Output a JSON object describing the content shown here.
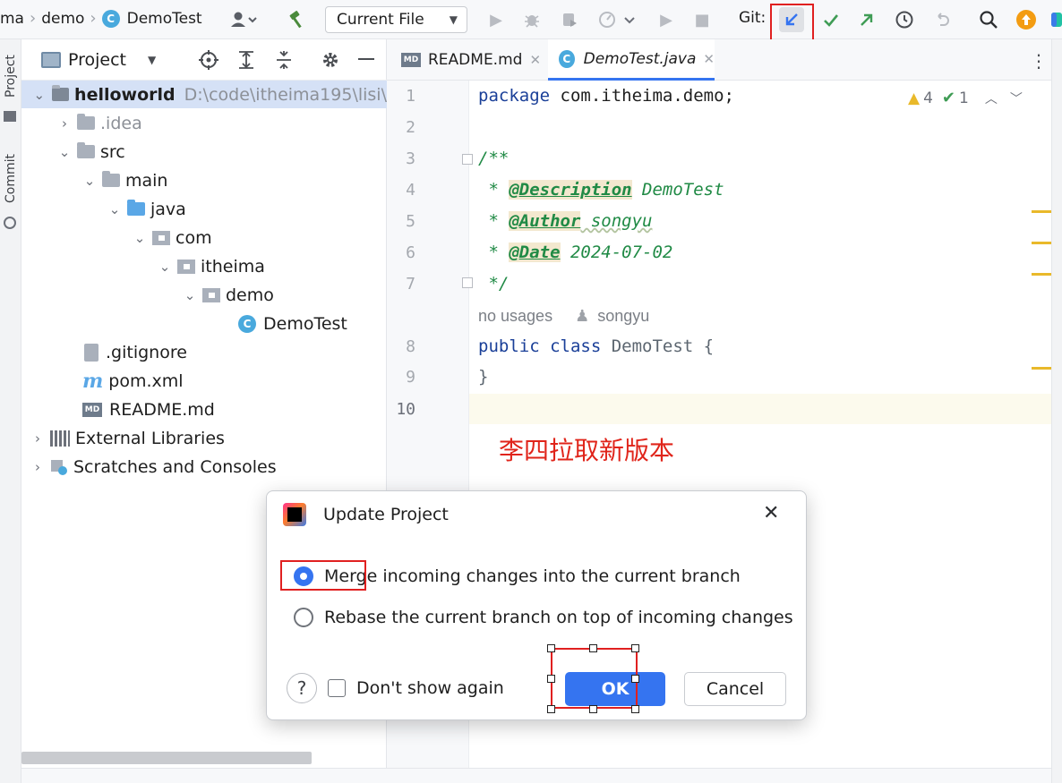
{
  "toolbar": {
    "breadcrumb_root": "ma",
    "breadcrumb_module": "demo",
    "breadcrumb_file": "DemoTest",
    "run_config": "Current File",
    "git_label": "Git:"
  },
  "left_strip": {
    "project_label": "Project",
    "commit_label": "Commit"
  },
  "project_panel": {
    "title": "Project",
    "tree": [
      {
        "label": "helloworld",
        "extra": "D:\\code\\itheima195\\lisi\\",
        "kind": "module"
      },
      {
        "label": ".idea",
        "kind": "folder"
      },
      {
        "label": "src",
        "kind": "folder"
      },
      {
        "label": "main",
        "kind": "folder"
      },
      {
        "label": "java",
        "kind": "folder-blue"
      },
      {
        "label": "com",
        "kind": "package"
      },
      {
        "label": "itheima",
        "kind": "package"
      },
      {
        "label": "demo",
        "kind": "package"
      },
      {
        "label": "DemoTest",
        "kind": "class"
      },
      {
        "label": ".gitignore",
        "kind": "file"
      },
      {
        "label": "pom.xml",
        "kind": "maven"
      },
      {
        "label": "README.md",
        "kind": "markdown"
      },
      {
        "label": "External Libraries",
        "kind": "libraries"
      },
      {
        "label": "Scratches and Consoles",
        "kind": "scratches"
      }
    ]
  },
  "editor": {
    "tabs": [
      {
        "label": "README.md",
        "icon": "markdown-icon",
        "active": false
      },
      {
        "label": "DemoTest.java",
        "icon": "class-icon",
        "active": true
      }
    ],
    "line_numbers": [
      "1",
      "2",
      "3",
      "4",
      "5",
      "6",
      "7",
      "8",
      "9",
      "10"
    ],
    "code": {
      "package_kw": "package",
      "package_name": " com.itheima.demo;",
      "doc_open": "/**",
      "doc_star": " * ",
      "tag_description": "@Description",
      "val_description": " DemoTest",
      "tag_author": "@Author",
      "val_author": " songyu",
      "tag_date": "@Date",
      "val_date": " 2024-07-02",
      "doc_close": " */",
      "hint_usages": "no usages",
      "hint_author": "songyu",
      "class_kw1": "public",
      "class_kw2": " class",
      "class_name": " DemoTest {",
      "close_brace": "}"
    },
    "inspection": {
      "warnings": "4",
      "ok": "1"
    },
    "annotation": "李四拉取新版本"
  },
  "dialog": {
    "title": "Update Project",
    "options": [
      {
        "label": "Merge incoming changes into the current branch",
        "selected": true
      },
      {
        "label": "Rebase the current branch on top of incoming changes",
        "selected": false
      }
    ],
    "help_label": "?",
    "dont_show": "Don't show again",
    "ok_label": "OK",
    "cancel_label": "Cancel"
  },
  "colors": {
    "accent": "#3574f0",
    "highlight_box": "#e02020",
    "warning": "#e9b92a",
    "doc_green": "#208a45",
    "keyword": "#1a3f98"
  }
}
